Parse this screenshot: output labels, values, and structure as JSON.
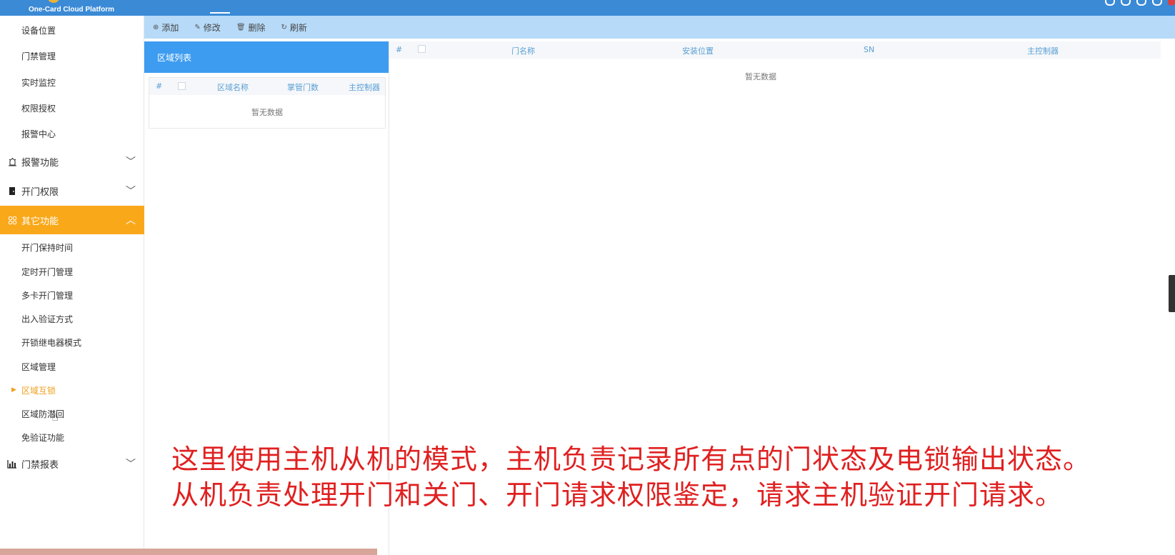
{
  "header": {
    "brand": "One-Card Cloud Platform"
  },
  "sidebar": {
    "top_items": [
      "设备位置",
      "门禁管理",
      "实时监控",
      "权限授权",
      "报警中心"
    ],
    "groups": [
      {
        "label": "报警功能",
        "icon": "alarm-icon",
        "expanded": false
      },
      {
        "label": "开门权限",
        "icon": "door-icon",
        "expanded": false
      },
      {
        "label": "其它功能",
        "icon": "grid-icon",
        "expanded": true
      }
    ],
    "sub_items": [
      "开门保持时间",
      "定时开门管理",
      "多卡开门管理",
      "出入验证方式",
      "开锁继电器模式",
      "区域管理",
      "区域互锁",
      "区域防潜回",
      "免验证功能"
    ],
    "current_item": "区域互锁",
    "last_group": {
      "label": "门禁报表",
      "icon": "bar-chart-icon",
      "expanded": false
    },
    "active_color": "#f9a81a"
  },
  "toolbar": {
    "add": "添加",
    "edit": "修改",
    "delete": "删除",
    "refresh": "刷新"
  },
  "region_panel": {
    "title": "区域列表",
    "columns": [
      "#",
      "区域名称",
      "掌管门数",
      "主控制器"
    ],
    "empty_text": "暂无数据"
  },
  "door_panel": {
    "columns": [
      "#",
      "门名称",
      "安装位置",
      "SN",
      "主控制器"
    ],
    "empty_text": "暂无数据"
  },
  "subtitles": {
    "line1": "这里使用主机从机的模式，主机负责记录所有点的门状态及电锁输出状态。",
    "line2": "从机负责处理开门和关门、开门请求权限鉴定，请求主机验证开门请求。"
  },
  "colors": {
    "topbar": "#3a8ad6",
    "toolbar": "#b6daf8",
    "panel_header": "#3d9cf0",
    "subtitle": "#e02020"
  }
}
